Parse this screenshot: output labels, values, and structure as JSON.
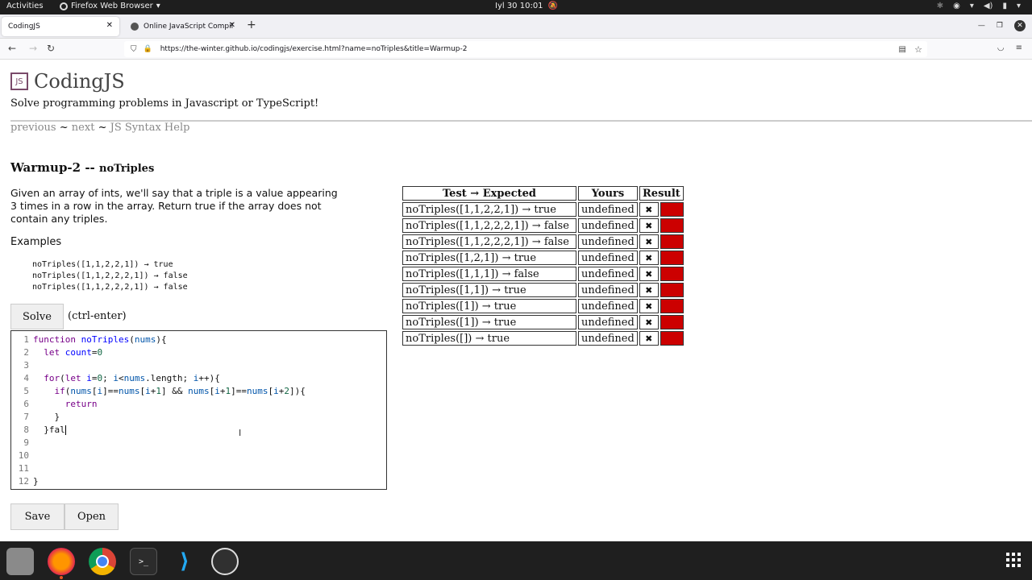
{
  "topbar": {
    "activities": "Activities",
    "app_name": "Firefox Web Browser",
    "clock": "Iyl 30  10:01"
  },
  "tabs": [
    {
      "label": "CodingJS",
      "active": true
    },
    {
      "label": "Online JavaScript Compil",
      "active": false
    }
  ],
  "urlbar": {
    "url": "https://the-winter.github.io/codingjs/exercise.html?name=noTriples&title=Warmup-2"
  },
  "header": {
    "title": "CodingJS",
    "tagline": "Solve programming problems in Javascript or TypeScript!"
  },
  "nav": {
    "previous": "previous",
    "next": "next",
    "help": "JS Syntax Help",
    "sep": "~"
  },
  "problem": {
    "category": "Warmup-2 --",
    "name": "noTriples",
    "description": "Given an array of ints, we'll say that a triple is a value appearing 3 times in a row in the array. Return true if the array does not contain any triples.",
    "examples_heading": "Examples",
    "examples": [
      "noTriples([1,1,2,2,1]) → true",
      "noTriples([1,1,2,2,2,1]) → false",
      "noTriples([1,1,2,2,2,1]) → false"
    ]
  },
  "actions": {
    "solve": "Solve",
    "shortcut": "(ctrl-enter)",
    "save": "Save",
    "open": "Open"
  },
  "editor": {
    "line_numbers": [
      "1",
      "2",
      "3",
      "4",
      "5",
      "6",
      "7",
      "8",
      "9",
      "10",
      "11",
      "12"
    ]
  },
  "tests": {
    "headers": [
      "Test → Expected",
      "Yours",
      "Result"
    ],
    "rows": [
      {
        "test": "noTriples([1,1,2,2,1]) → true",
        "yours": "undefined",
        "mark": "✖"
      },
      {
        "test": "noTriples([1,1,2,2,2,1]) → false",
        "yours": "undefined",
        "mark": "✖"
      },
      {
        "test": "noTriples([1,1,2,2,2,1]) → false",
        "yours": "undefined",
        "mark": "✖"
      },
      {
        "test": "noTriples([1,2,1]) → true",
        "yours": "undefined",
        "mark": "✖"
      },
      {
        "test": "noTriples([1,1,1]) → false",
        "yours": "undefined",
        "mark": "✖"
      },
      {
        "test": "noTriples([1,1]) → true",
        "yours": "undefined",
        "mark": "✖"
      },
      {
        "test": "noTriples([1]) → true",
        "yours": "undefined",
        "mark": "✖"
      },
      {
        "test": "noTriples([1]) → true",
        "yours": "undefined",
        "mark": "✖"
      },
      {
        "test": "noTriples([]) → true",
        "yours": "undefined",
        "mark": "✖"
      }
    ],
    "fail_color": "#cc0000"
  },
  "dock": {
    "icons": [
      "files-icon",
      "firefox-icon",
      "chrome-icon",
      "terminal-icon",
      "vscode-icon",
      "obs-icon",
      "app-grid-icon"
    ],
    "terminal_glyph": ">_"
  }
}
